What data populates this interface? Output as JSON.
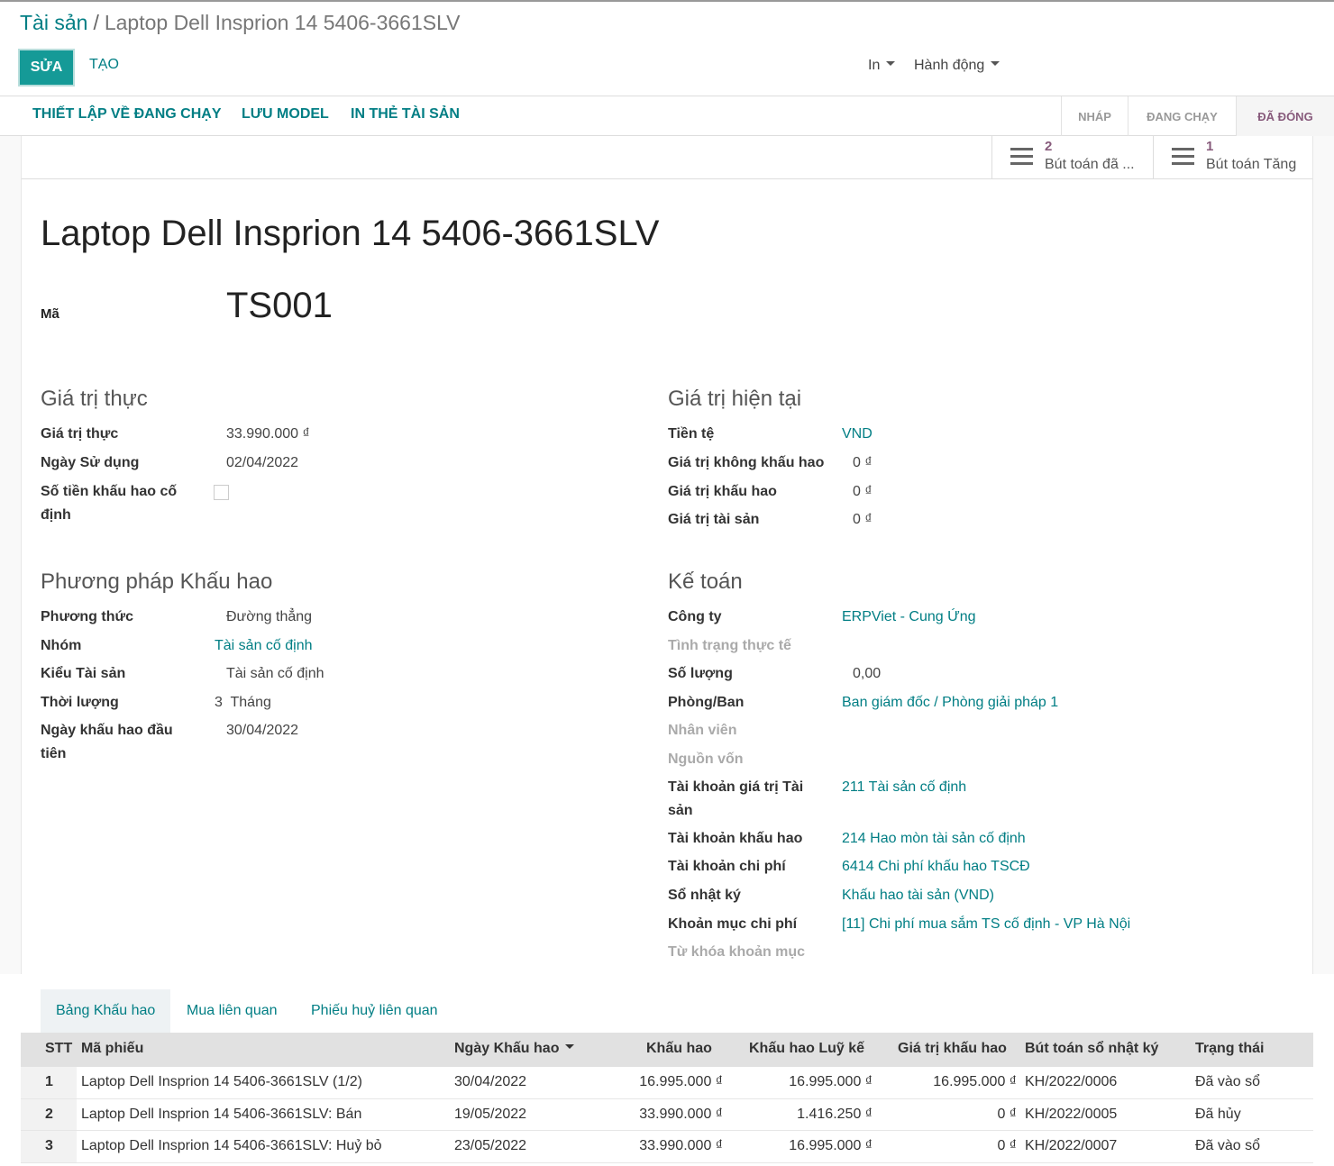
{
  "breadcrumb": {
    "parent": "Tài sản",
    "separator": "/",
    "current": "Laptop Dell Insprion 14 5406-3661SLV"
  },
  "toolbar": {
    "edit_label": "SỬA",
    "create_label": "TẠO",
    "print_label": "In",
    "action_label": "Hành động"
  },
  "statusbar": {
    "buttons": [
      "THIẾT LẬP VỀ ĐANG CHẠY",
      "LƯU MODEL",
      "IN THẺ TÀI SẢN"
    ],
    "stages": [
      "NHÁP",
      "ĐANG CHẠY",
      "ĐÃ ĐÓNG"
    ],
    "active_stage": "ĐÃ ĐÓNG"
  },
  "smart_buttons": [
    {
      "count": "2",
      "label": "Bút toán đã ...",
      "icon": "list-icon"
    },
    {
      "count": "1",
      "label": "Bút toán Tăng",
      "icon": "list-icon"
    }
  ],
  "record": {
    "title": "Laptop Dell Insprion 14 5406-3661SLV",
    "code_label": "Mã",
    "code": "TS001"
  },
  "gia_tri_thuc": {
    "title": "Giá trị thực",
    "fields": [
      {
        "label": "Giá trị thực",
        "value": "33.990.000 ₫"
      },
      {
        "label": "Ngày Sử dụng",
        "value": "02/04/2022"
      },
      {
        "label": "Số tiền khấu hao cố định",
        "value": ""
      }
    ]
  },
  "gia_tri_hien_tai": {
    "title": "Giá trị hiện tại",
    "fields": [
      {
        "label": "Tiền tệ",
        "value": "VND"
      },
      {
        "label": "Giá trị không khấu hao",
        "value": "0 ₫"
      },
      {
        "label": "Giá trị khấu hao",
        "value": "0 ₫"
      },
      {
        "label": "Giá trị tài sản",
        "value": "0 ₫"
      }
    ]
  },
  "phuong_phap": {
    "title": "Phương pháp Khấu hao",
    "fields": [
      {
        "label": "Phương thức",
        "value": "Đường thẳng"
      },
      {
        "label": "Nhóm",
        "value": "Tài sản cố định"
      },
      {
        "label": "Kiểu Tài sản",
        "value": "Tài sản cố định"
      },
      {
        "label": "Thời lượng",
        "value": "3  Tháng"
      },
      {
        "label": "Ngày khấu hao đầu tiên",
        "value": "30/04/2022"
      }
    ]
  },
  "ke_toan": {
    "title": "Kế toán",
    "fields": [
      {
        "label": "Công ty",
        "value": "ERPViet - Cung Ứng"
      },
      {
        "label": "Tình trạng thực tế",
        "value": ""
      },
      {
        "label": "Số lượng",
        "value": "0,00"
      },
      {
        "label": "Phòng/Ban",
        "value": "Ban giám đốc / Phòng giải pháp 1"
      },
      {
        "label": "Nhân viên",
        "value": ""
      },
      {
        "label": "Nguồn vốn",
        "value": ""
      },
      {
        "label": "Tài khoản giá trị Tài sản",
        "value": "211 Tài sản cố định"
      },
      {
        "label": "Tài khoản khấu hao",
        "value": "214 Hao mòn tài sản cố định"
      },
      {
        "label": "Tài khoản chi phí",
        "value": "6414 Chi phí khấu hao TSCĐ"
      },
      {
        "label": "Sổ nhật ký",
        "value": "Khấu hao tài sản (VND)"
      },
      {
        "label": "Khoản mục chi phí",
        "value": "[11] Chi phí mua sắm TS cố định - VP Hà Nội"
      },
      {
        "label": "Từ khóa khoản mục",
        "value": ""
      }
    ]
  },
  "notebook": {
    "tabs": [
      "Bảng Khấu hao",
      "Mua liên quan",
      "Phiếu huỷ liên quan"
    ],
    "active_tab": "Bảng Khấu hao",
    "columns": [
      "STT",
      "Mã phiếu",
      "Ngày Khấu hao",
      "Khấu hao",
      "Khấu hao Luỹ kế",
      "Giá trị khấu hao",
      "Bút toán sổ nhật ký",
      "Trạng thái"
    ],
    "rows": [
      {
        "stt": "1",
        "ma_phieu": "Laptop Dell Insprion 14 5406-3661SLV (1/2)",
        "ngay": "30/04/2022",
        "khau_hao": "16.995.000 ₫",
        "luy_ke": "16.995.000 ₫",
        "gia_tri": "16.995.000 ₫",
        "but_toan": "KH/2022/0006",
        "trang_thai": "Đã vào sổ"
      },
      {
        "stt": "2",
        "ma_phieu": "Laptop Dell Insprion 14 5406-3661SLV: Bán",
        "ngay": "19/05/2022",
        "khau_hao": "33.990.000 ₫",
        "luy_ke": "1.416.250 ₫",
        "gia_tri": "0 ₫",
        "but_toan": "KH/2022/0005",
        "trang_thai": "Đã hủy"
      },
      {
        "stt": "3",
        "ma_phieu": "Laptop Dell Insprion 14 5406-3661SLV: Huỷ bỏ",
        "ngay": "23/05/2022",
        "khau_hao": "33.990.000 ₫",
        "luy_ke": "16.995.000 ₫",
        "gia_tri": "0 ₫",
        "but_toan": "KH/2022/0007",
        "trang_thai": "Đã vào sổ"
      }
    ]
  },
  "colors": {
    "primary": "#017e84",
    "edit_button": "#159a97",
    "stage_active": "#875a7b"
  }
}
